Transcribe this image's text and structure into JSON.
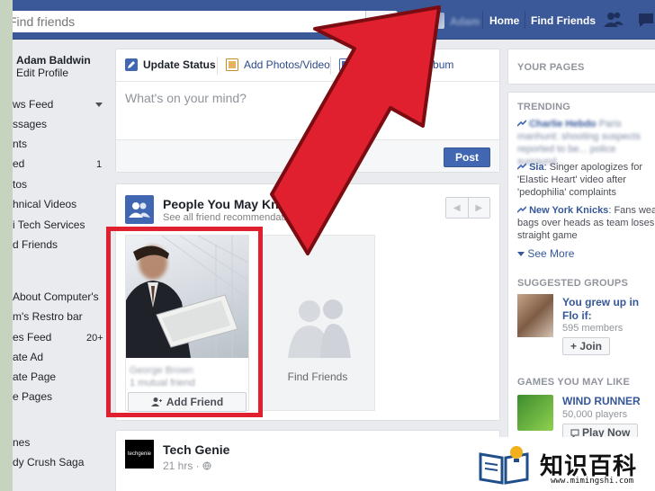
{
  "topbar": {
    "search_placeholder": "Find friends",
    "user_name": "Adam",
    "home": "Home",
    "find_friends": "Find Friends"
  },
  "left": {
    "profile_name": "Adam Baldwin",
    "edit_profile": "Edit Profile",
    "items": [
      {
        "label": "ws Feed",
        "count": ""
      },
      {
        "label": "ssages",
        "count": ""
      },
      {
        "label": "nts",
        "count": ""
      },
      {
        "label": "ed",
        "count": "1"
      },
      {
        "label": "tos",
        "count": ""
      },
      {
        "label": "hnical Videos",
        "count": ""
      },
      {
        "label": "i Tech Services",
        "count": ""
      },
      {
        "label": "d Friends",
        "count": ""
      },
      {
        "label": "About Computer's",
        "count": ""
      },
      {
        "label": "m's Restro bar",
        "count": ""
      },
      {
        "label": "es Feed",
        "count": "20+"
      },
      {
        "label": "ate Ad",
        "count": ""
      },
      {
        "label": "ate Page",
        "count": ""
      },
      {
        "label": "e Pages",
        "count": ""
      },
      {
        "label": "nes",
        "count": ""
      },
      {
        "label": "dy Crush Saga",
        "count": ""
      }
    ]
  },
  "composer": {
    "tab_status": "Update Status",
    "tab_photos": "Add Photos/Video",
    "tab_album": "Create Photo Album",
    "placeholder": "What's on your mind?",
    "post": "Post"
  },
  "pymk": {
    "title": "People You May Know",
    "subtitle": "See all friend recommendations",
    "person_name": "George Brown",
    "person_mutual": "1 mutual friend",
    "add_friend": "Add Friend",
    "find_friends": "Find Friends"
  },
  "feed_post": {
    "author": "Tech Genie",
    "logo_text": "techgenie",
    "time": "21 hrs ·"
  },
  "right": {
    "your_pages": "YOUR PAGES",
    "trending": "TRENDING",
    "trends": [
      {
        "name": "Charlie Hebdo",
        "text": "Paris manhunt: shooting suspects reported to be... police surround..."
      },
      {
        "name": "Sia",
        "text": "Singer apologizes for 'Elastic Heart' video after 'pedophilia' complaints"
      },
      {
        "name": "New York Knicks",
        "text": "Fans wear bags over heads as team loses straight game"
      }
    ],
    "see_more": "See More",
    "suggested_groups": "SUGGESTED GROUPS",
    "group_name": "You grew up in Flo if:",
    "group_members": "595 members",
    "join": "+ Join",
    "games": "GAMES YOU MAY LIKE",
    "game_name": "WIND RUNNER",
    "game_players": "50,000 players",
    "play_now": "Play Now"
  },
  "watermark": {
    "text": "知识百科",
    "url": "www.mimingshi.com"
  }
}
